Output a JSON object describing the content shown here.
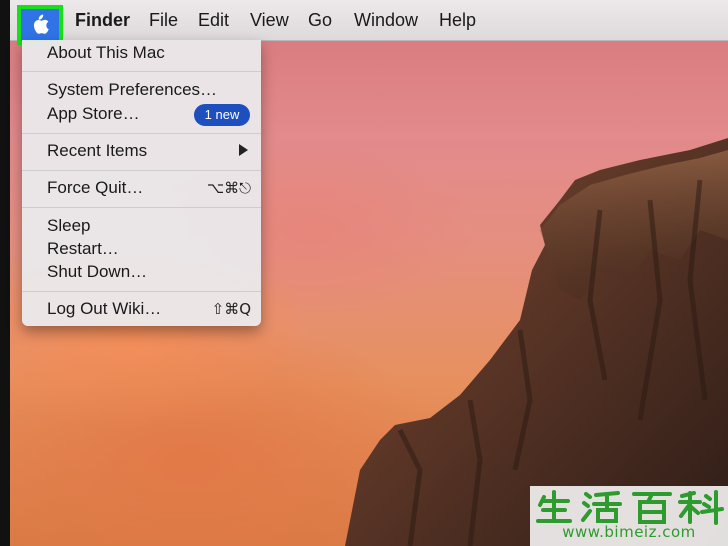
{
  "menubar": {
    "apple_icon": "apple-logo-icon",
    "items": [
      "Finder",
      "File",
      "Edit",
      "View",
      "Go",
      "Window",
      "Help"
    ]
  },
  "apple_menu": {
    "about": "About This Mac",
    "system_preferences": "System Preferences…",
    "app_store": "App Store…",
    "app_store_badge": "1 new",
    "recent_items": "Recent Items",
    "force_quit": "Force Quit…",
    "force_quit_shortcut": "⌥⌘⎋",
    "sleep": "Sleep",
    "restart": "Restart…",
    "shut_down": "Shut Down…",
    "log_out": "Log Out Wiki…",
    "log_out_shortcut": "⇧⌘Q"
  },
  "watermark": {
    "chars": "生活百科",
    "url": "www.bimeiz.com"
  },
  "colors": {
    "highlight_box": "#18e018",
    "apple_selected": "#2f73e6",
    "badge": "#1d4fbf",
    "watermark_green": "#2d9b2d"
  }
}
